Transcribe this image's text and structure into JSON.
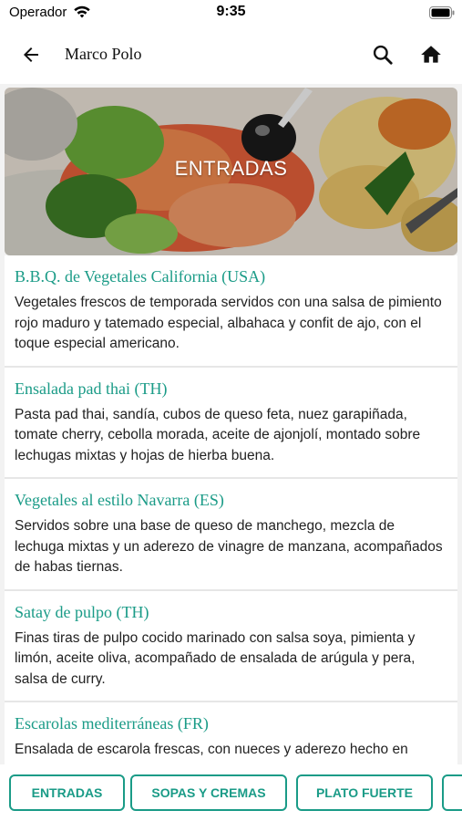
{
  "status_bar": {
    "carrier": "Operador",
    "time": "9:35",
    "icons": [
      "wifi-icon",
      "battery-icon"
    ]
  },
  "header": {
    "title": "Marco Polo",
    "icons": [
      "back-arrow-icon",
      "search-icon",
      "home-icon"
    ]
  },
  "hero": {
    "title": "ENTRADAS"
  },
  "menu_items": [
    {
      "name": "B.B.Q. de Vegetales California (USA)",
      "description": "Vegetales frescos de temporada servidos con una salsa de pimiento rojo maduro y tatemado especial, albahaca y confit de ajo, con el toque especial americano."
    },
    {
      "name": "Ensalada pad thai (TH)",
      "description": "Pasta pad thai, sandía, cubos de queso feta, nuez garapiñada, tomate cherry, cebolla morada, aceite de ajonjolí, montado sobre lechugas mixtas y hojas de hierba buena."
    },
    {
      "name": "Vegetales al estilo Navarra (ES)",
      "description": "Servidos sobre una base de queso de manchego, mezcla de lechuga mixtas y un aderezo de vinagre de manzana, acompañados de habas tiernas."
    },
    {
      "name": "Satay de pulpo (TH)",
      "description": "Finas tiras de pulpo cocido marinado con salsa soya, pimienta y limón, aceite oliva, acompañado de ensalada de arúgula y pera, salsa de curry."
    },
    {
      "name": "Escarolas mediterráneas (FR)",
      "description": "Ensalada de escarola frescas, con nueces y aderezo hecho en"
    }
  ],
  "tabs": [
    "ENTRADAS",
    "SOPAS Y CREMAS",
    "PLATO FUERTE",
    ""
  ],
  "colors": {
    "accent": "#1a9b87",
    "text": "#222222",
    "background": "#f2f2f2"
  }
}
